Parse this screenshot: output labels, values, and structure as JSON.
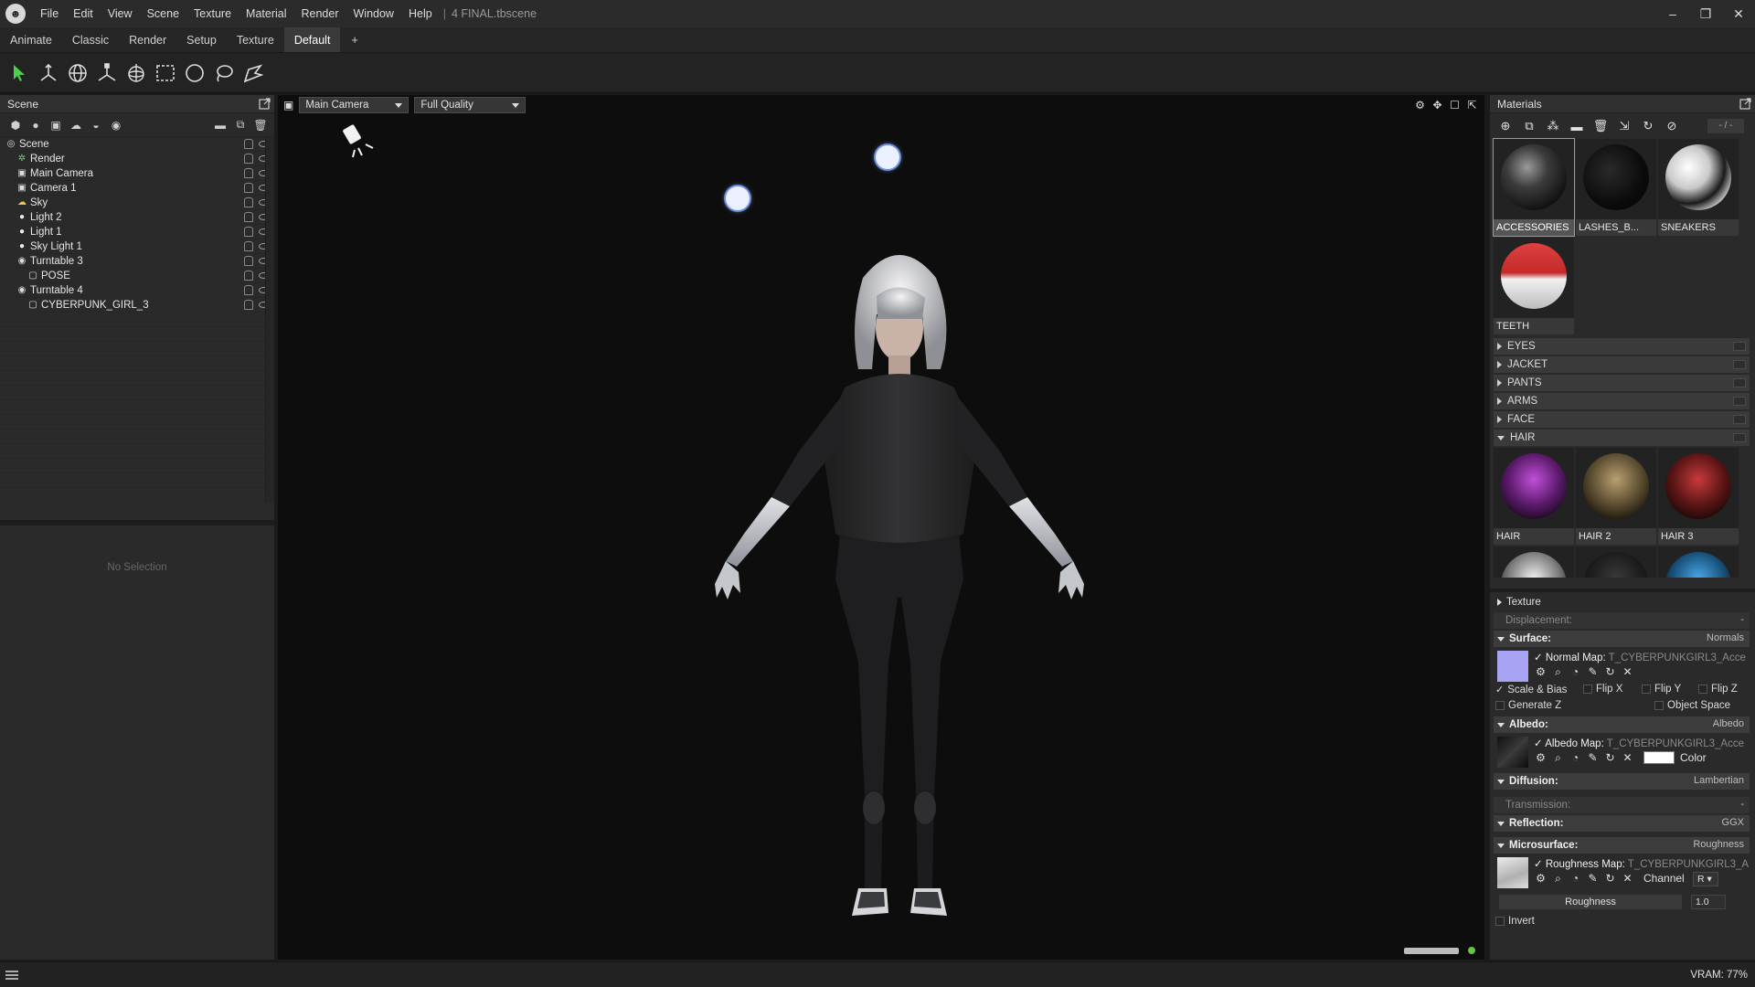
{
  "titlebar": {
    "menu": [
      "File",
      "Edit",
      "View",
      "Scene",
      "Texture",
      "Material",
      "Render",
      "Window",
      "Help"
    ],
    "separator": "|",
    "document": "4 FINAL.tbscene",
    "minimize": "–",
    "maximize": "❐",
    "close": "✕"
  },
  "workspace_tabs": [
    "Animate",
    "Classic",
    "Render",
    "Setup",
    "Texture",
    "Default",
    "+"
  ],
  "active_tab": "Default",
  "toolbar": {
    "tools": [
      "select-tool",
      "move-tool",
      "rotate-tool",
      "scale-tool",
      "pivot-tool",
      "rect-select-tool",
      "ellipse-select-tool",
      "lasso-select-tool",
      "paint-select-tool"
    ],
    "accent": "#4cd04c"
  },
  "scene": {
    "title": "Scene",
    "tree": [
      {
        "label": "Scene",
        "indent": 0,
        "icon": "scene-icon"
      },
      {
        "label": "Render",
        "indent": 1,
        "icon": "render-icon"
      },
      {
        "label": "Main Camera",
        "indent": 1,
        "icon": "camera-icon"
      },
      {
        "label": "Camera 1",
        "indent": 1,
        "icon": "camera-icon"
      },
      {
        "label": "Sky",
        "indent": 1,
        "icon": "sky-icon"
      },
      {
        "label": "Light 2",
        "indent": 1,
        "icon": "light-icon"
      },
      {
        "label": "Light 1",
        "indent": 1,
        "icon": "light-icon"
      },
      {
        "label": "Sky Light 1",
        "indent": 1,
        "icon": "light-icon"
      },
      {
        "label": "Turntable 3",
        "indent": 1,
        "icon": "turntable-icon"
      },
      {
        "label": "POSE",
        "indent": 2,
        "icon": "mesh-icon"
      },
      {
        "label": "Turntable 4",
        "indent": 1,
        "icon": "turntable-icon"
      },
      {
        "label": "CYBERPUNK_GIRL_3",
        "indent": 2,
        "icon": "mesh-icon"
      }
    ]
  },
  "properties": {
    "empty_text": "No Selection"
  },
  "viewport": {
    "camera": "Main Camera",
    "quality": "Full Quality",
    "status_color": "#69c24a"
  },
  "materials": {
    "title": "Materials",
    "count": "- / -",
    "top_tiles": [
      {
        "label": "ACCESSORIES",
        "style": "dark-sphere",
        "selected": true
      },
      {
        "label": "LASHES_B...",
        "style": "black-sphere",
        "selected": false
      },
      {
        "label": "SNEAKERS",
        "style": "white-black-sphere",
        "selected": false
      },
      {
        "label": "TEETH",
        "style": "red-white-sphere",
        "selected": false
      }
    ],
    "groups": [
      {
        "label": "EYES",
        "open": false
      },
      {
        "label": "JACKET",
        "open": false
      },
      {
        "label": "PANTS",
        "open": false
      },
      {
        "label": "ARMS",
        "open": false
      },
      {
        "label": "FACE",
        "open": false
      },
      {
        "label": "HAIR",
        "open": true
      }
    ],
    "hair_tiles": [
      {
        "label": "HAIR",
        "style": "purple-hair"
      },
      {
        "label": "HAIR 2",
        "style": "gold-hair"
      },
      {
        "label": "HAIR 3",
        "style": "red-hair"
      },
      {
        "label": "",
        "style": "white-hair"
      },
      {
        "label": "",
        "style": "dark-hair"
      },
      {
        "label": "",
        "style": "blue-hair"
      }
    ]
  },
  "mat_props": {
    "texture": "Texture",
    "displacement": {
      "label": "Displacement:",
      "value": "-"
    },
    "surface": {
      "label": "Surface:",
      "value": "Normals"
    },
    "normal_map": {
      "label": "Normal Map:",
      "file": "T_CYBERPUNKGIRL3_Acce"
    },
    "options1": [
      "Scale & Bias",
      "Flip X",
      "Flip Y",
      "Flip Z"
    ],
    "options2": [
      "Generate Z",
      "Object Space"
    ],
    "albedo": {
      "label": "Albedo:",
      "value": "Albedo"
    },
    "albedo_map": {
      "label": "Albedo Map:",
      "file": "T_CYBERPUNKGIRL3_Acce",
      "color_label": "Color",
      "color": "#ffffff"
    },
    "diffusion": {
      "label": "Diffusion:",
      "value": "Lambertian"
    },
    "transmission": {
      "label": "Transmission:",
      "value": "-"
    },
    "reflection": {
      "label": "Reflection:",
      "value": "GGX"
    },
    "microsurface": {
      "label": "Microsurface:",
      "value": "Roughness"
    },
    "roughness_map": {
      "label": "Roughness Map:",
      "file": "T_CYBERPUNKGIRL3_A",
      "channel_label": "Channel",
      "channel": "R"
    },
    "roughness": {
      "label": "Roughness",
      "value": "1.0"
    },
    "invert": "Invert"
  },
  "status": {
    "vram": "VRAM: 77%"
  }
}
